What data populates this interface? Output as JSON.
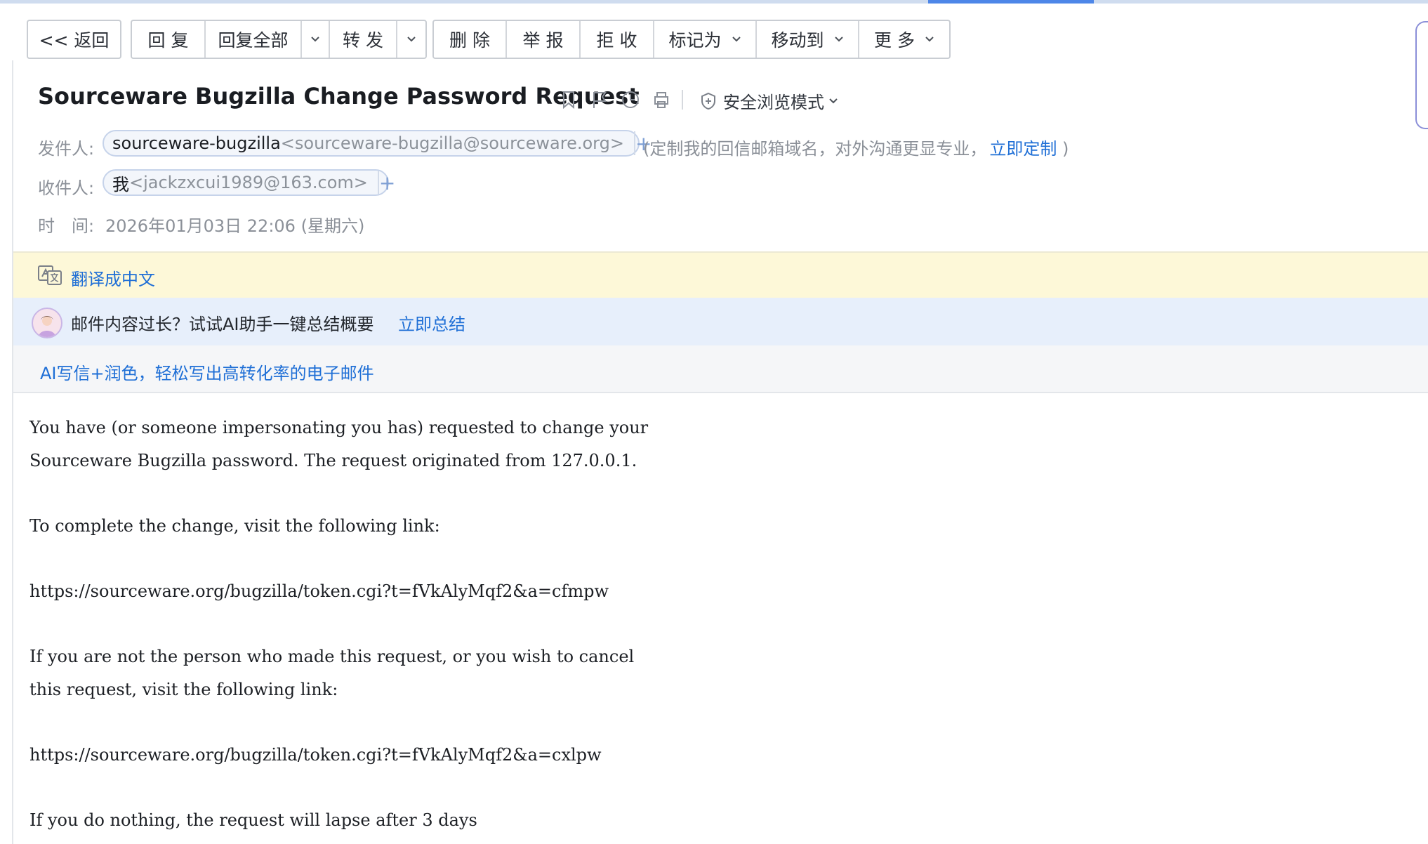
{
  "toolbar": {
    "back_label": "<< 返回",
    "reply_label": "回 复",
    "reply_all_label": "回复全部",
    "forward_label": "转 发",
    "delete_label": "删 除",
    "report_label": "举 报",
    "reject_label": "拒 收",
    "mark_as_label": "标记为",
    "move_to_label": "移动到",
    "more_label": "更 多"
  },
  "mail": {
    "subject": "Sourceware Bugzilla Change Password Request",
    "safe_mode_label": "安全浏览模式",
    "from_label": "发件人:",
    "from_name": "sourceware-bugzilla",
    "from_address": "<sourceware-bugzilla@sourceware.org>",
    "from_note": "(定制我的回信邮箱域名，对外沟通更显专业，",
    "from_note_link": "立即定制",
    "from_note_close": ")",
    "to_label": "收件人:",
    "to_name": "我",
    "to_address": "<jackzxcui1989@163.com>",
    "time_label": "时　间:",
    "time_value": "2026年01月03日 22:06 (星期六)"
  },
  "translate_bar": {
    "link_label": "翻译成中文"
  },
  "ai_bar": {
    "text": "邮件内容过长？试试AI助手一键总结概要",
    "link_label": "立即总结"
  },
  "write_bar": {
    "link_label": "AI写信+润色，轻松写出高转化率的电子邮件"
  },
  "body_lines": [
    "You have (or someone impersonating you has) requested to change your",
    "Sourceware Bugzilla password. The request originated from 127.0.0.1.",
    "",
    "To complete the change, visit the following link:",
    "",
    "https://sourceware.org/bugzilla/token.cgi?t=fVkAlyMqf2&a=cfmpw",
    "",
    "If you are not the person who made this request, or you wish to cancel",
    "this request, visit the following link:",
    "",
    "https://sourceware.org/bugzilla/token.cgi?t=fVkAlyMqf2&a=cxlpw",
    "",
    "If you do nothing, the request will lapse after 3 days"
  ],
  "colors": {
    "accent": "#1f6fd6",
    "translate_bar_bg": "#fdf8d8",
    "ai_bar_bg": "#e7effb",
    "write_bar_bg": "#f5f6f8"
  },
  "icons": [
    "bookmark-icon",
    "flag-icon",
    "clock-icon",
    "print-icon",
    "shield-icon",
    "translate-icon",
    "assistant-avatar",
    "chevron-down-icon"
  ]
}
